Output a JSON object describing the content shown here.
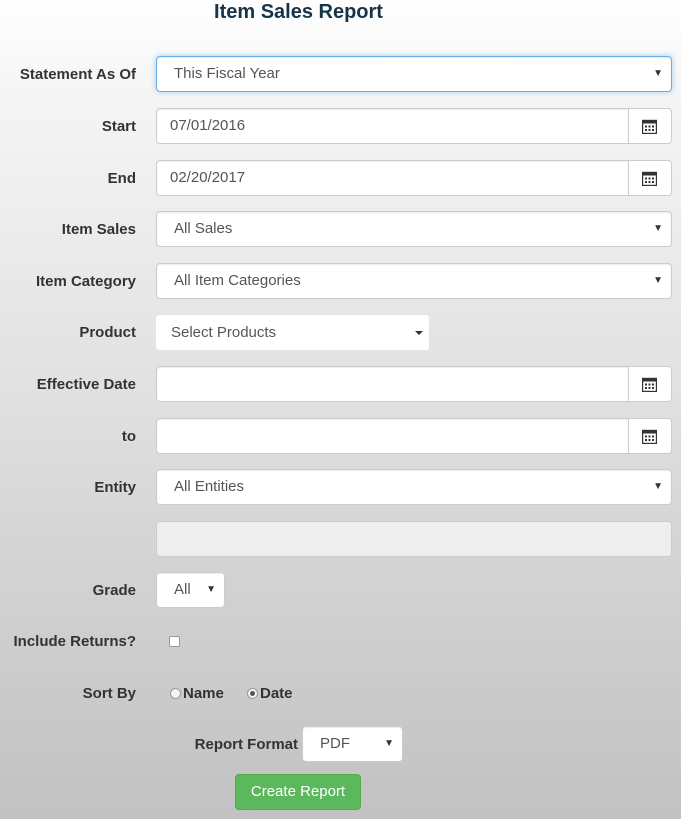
{
  "page": {
    "title": "Item Sales Report"
  },
  "form": {
    "statement_as_of": {
      "label": "Statement As Of",
      "value": "This Fiscal Year"
    },
    "start": {
      "label": "Start",
      "value": "07/01/2016"
    },
    "end": {
      "label": "End",
      "value": "02/20/2017"
    },
    "item_sales": {
      "label": "Item Sales",
      "value": "All Sales"
    },
    "item_category": {
      "label": "Item Category",
      "value": "All Item Categories"
    },
    "product": {
      "label": "Product",
      "value": "Select Products"
    },
    "effective_date": {
      "label": "Effective Date",
      "value": ""
    },
    "to": {
      "label": "to",
      "value": ""
    },
    "entity": {
      "label": "Entity",
      "value": "All Entities"
    },
    "grade": {
      "label": "Grade",
      "value": "All"
    },
    "include_returns": {
      "label": "Include Returns?",
      "checked": false
    },
    "sort_by": {
      "label": "Sort By",
      "options": [
        {
          "label": "Name",
          "checked": false
        },
        {
          "label": "Date",
          "checked": true
        }
      ]
    },
    "report_format": {
      "label": "Report Format",
      "value": "PDF"
    },
    "create_button": {
      "label": "Create Report"
    }
  },
  "icons": {
    "calendar": "calendar-icon",
    "caret": "caret-down-icon"
  }
}
